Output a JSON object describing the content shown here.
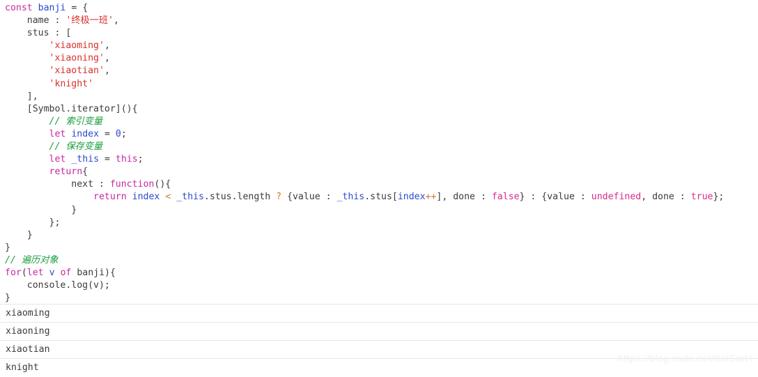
{
  "editor": {
    "language": "javascript",
    "lines": [
      {
        "n": 1,
        "indent": 0,
        "tokens": [
          {
            "t": "const",
            "c": "kw"
          },
          {
            "t": " ",
            "c": "plain"
          },
          {
            "t": "banji",
            "c": "var"
          },
          {
            "t": " ",
            "c": "plain"
          },
          {
            "t": "=",
            "c": "plain"
          },
          {
            "t": " {",
            "c": "plain"
          }
        ]
      },
      {
        "n": 2,
        "indent": 1,
        "tokens": [
          {
            "t": "name : ",
            "c": "plain"
          },
          {
            "t": "'终极一班'",
            "c": "cn-str"
          },
          {
            "t": ",",
            "c": "plain"
          }
        ]
      },
      {
        "n": 3,
        "indent": 1,
        "tokens": [
          {
            "t": "stus : [",
            "c": "plain"
          }
        ]
      },
      {
        "n": 4,
        "indent": 2,
        "tokens": [
          {
            "t": "'xiaoming'",
            "c": "str"
          },
          {
            "t": ",",
            "c": "plain"
          }
        ]
      },
      {
        "n": 5,
        "indent": 2,
        "tokens": [
          {
            "t": "'xiaoning'",
            "c": "str"
          },
          {
            "t": ",",
            "c": "plain"
          }
        ]
      },
      {
        "n": 6,
        "indent": 2,
        "tokens": [
          {
            "t": "'xiaotian'",
            "c": "str"
          },
          {
            "t": ",",
            "c": "plain"
          }
        ]
      },
      {
        "n": 7,
        "indent": 2,
        "tokens": [
          {
            "t": "'knight'",
            "c": "str"
          }
        ]
      },
      {
        "n": 8,
        "indent": 1,
        "tokens": [
          {
            "t": "],",
            "c": "plain"
          }
        ]
      },
      {
        "n": 9,
        "indent": 1,
        "tokens": [
          {
            "t": "[Symbol.iterator](){",
            "c": "plain"
          }
        ]
      },
      {
        "n": 10,
        "indent": 2,
        "tokens": [
          {
            "t": "// 索引变量",
            "c": "cmt"
          }
        ]
      },
      {
        "n": 11,
        "indent": 2,
        "tokens": [
          {
            "t": "let",
            "c": "kw"
          },
          {
            "t": " ",
            "c": "plain"
          },
          {
            "t": "index",
            "c": "var"
          },
          {
            "t": " ",
            "c": "plain"
          },
          {
            "t": "=",
            "c": "plain"
          },
          {
            "t": " ",
            "c": "plain"
          },
          {
            "t": "0",
            "c": "var"
          },
          {
            "t": ";",
            "c": "plain"
          }
        ]
      },
      {
        "n": 12,
        "indent": 2,
        "tokens": [
          {
            "t": "// 保存变量",
            "c": "cmt"
          }
        ]
      },
      {
        "n": 13,
        "indent": 2,
        "tokens": [
          {
            "t": "let",
            "c": "kw"
          },
          {
            "t": " ",
            "c": "plain"
          },
          {
            "t": "_this",
            "c": "var"
          },
          {
            "t": " ",
            "c": "plain"
          },
          {
            "t": "=",
            "c": "plain"
          },
          {
            "t": " ",
            "c": "plain"
          },
          {
            "t": "this",
            "c": "kw"
          },
          {
            "t": ";",
            "c": "plain"
          }
        ]
      },
      {
        "n": 14,
        "indent": 2,
        "tokens": [
          {
            "t": "return",
            "c": "kw"
          },
          {
            "t": "{",
            "c": "plain"
          }
        ]
      },
      {
        "n": 15,
        "indent": 3,
        "tokens": [
          {
            "t": "next : ",
            "c": "plain"
          },
          {
            "t": "function",
            "c": "kw"
          },
          {
            "t": "(){",
            "c": "plain"
          }
        ]
      },
      {
        "n": 16,
        "indent": 4,
        "tokens": [
          {
            "t": "return",
            "c": "kw"
          },
          {
            "t": " ",
            "c": "plain"
          },
          {
            "t": "index",
            "c": "var"
          },
          {
            "t": " ",
            "c": "plain"
          },
          {
            "t": "<",
            "c": "op"
          },
          {
            "t": " ",
            "c": "plain"
          },
          {
            "t": "_this",
            "c": "var"
          },
          {
            "t": ".stus.length ",
            "c": "plain"
          },
          {
            "t": "?",
            "c": "op"
          },
          {
            "t": " {value : ",
            "c": "plain"
          },
          {
            "t": "_this",
            "c": "var"
          },
          {
            "t": ".stus[",
            "c": "plain"
          },
          {
            "t": "index",
            "c": "var"
          },
          {
            "t": "++",
            "c": "op"
          },
          {
            "t": "], done : ",
            "c": "plain"
          },
          {
            "t": "false",
            "c": "lit"
          },
          {
            "t": "} : {value : ",
            "c": "plain"
          },
          {
            "t": "undefined",
            "c": "lit"
          },
          {
            "t": ", done : ",
            "c": "plain"
          },
          {
            "t": "true",
            "c": "lit"
          },
          {
            "t": "};",
            "c": "plain"
          }
        ]
      },
      {
        "n": 17,
        "indent": 3,
        "tokens": [
          {
            "t": "}",
            "c": "plain"
          }
        ]
      },
      {
        "n": 18,
        "indent": 2,
        "tokens": [
          {
            "t": "};",
            "c": "plain"
          }
        ]
      },
      {
        "n": 19,
        "indent": 1,
        "tokens": [
          {
            "t": "}",
            "c": "plain"
          }
        ]
      },
      {
        "n": 20,
        "indent": 0,
        "tokens": [
          {
            "t": "}",
            "c": "plain"
          }
        ]
      },
      {
        "n": 21,
        "indent": 0,
        "tokens": [
          {
            "t": "// 遍历对象",
            "c": "cmt"
          }
        ]
      },
      {
        "n": 22,
        "indent": 0,
        "tokens": [
          {
            "t": "for",
            "c": "kw"
          },
          {
            "t": "(",
            "c": "plain"
          },
          {
            "t": "let",
            "c": "kw"
          },
          {
            "t": " ",
            "c": "plain"
          },
          {
            "t": "v",
            "c": "var"
          },
          {
            "t": " ",
            "c": "plain"
          },
          {
            "t": "of",
            "c": "kw"
          },
          {
            "t": " ",
            "c": "plain"
          },
          {
            "t": "banji",
            "c": "plain"
          },
          {
            "t": "){",
            "c": "plain"
          }
        ]
      },
      {
        "n": 23,
        "indent": 1,
        "tokens": [
          {
            "t": "console.log(v);",
            "c": "plain"
          }
        ]
      },
      {
        "n": 24,
        "indent": 0,
        "tokens": [
          {
            "t": "}",
            "c": "plain"
          }
        ]
      }
    ]
  },
  "console": {
    "rows": [
      "xiaoming",
      "xiaoning",
      "xiaotian",
      "knight"
    ]
  },
  "watermark": {
    "text": "https://blog.csdn.net/KaiSarH"
  },
  "colors": {
    "background": "#ffffff",
    "text": "#3b3b3b",
    "keyword": "#c828a0",
    "identifier": "#2a49cc",
    "string": "#d9302a",
    "comment": "#1a9c3c",
    "operator": "#d4761f",
    "literal": "#d92b8e",
    "console_divider": "#e6e6e6",
    "watermark": "#f0f0f0"
  }
}
